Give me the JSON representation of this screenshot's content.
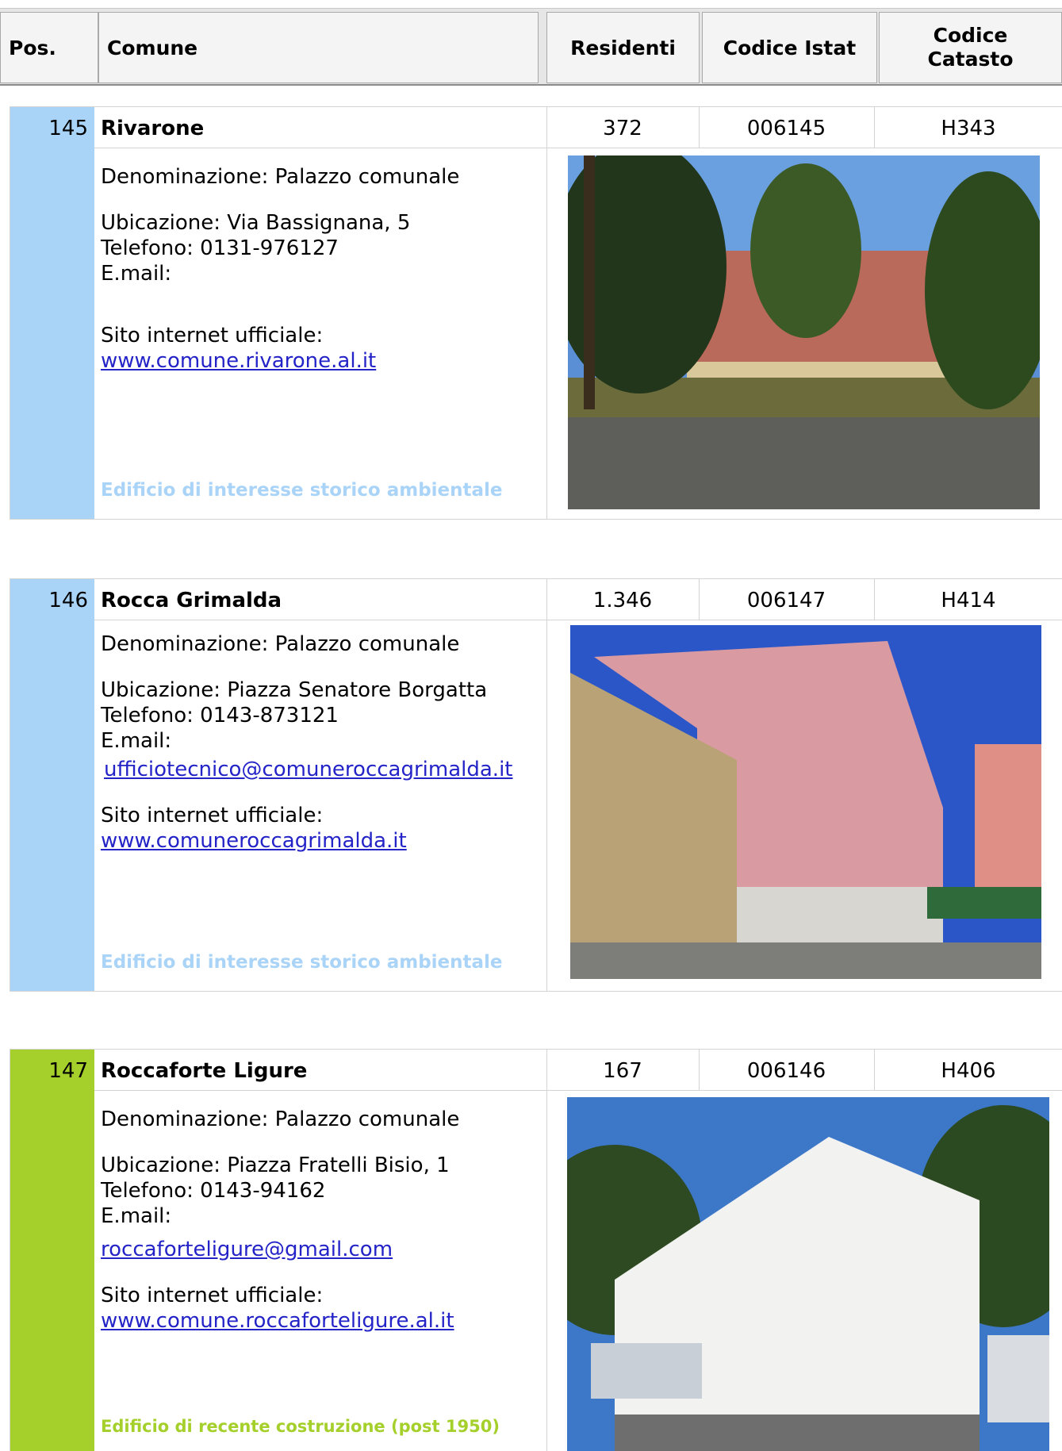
{
  "header": {
    "pos": "Pos.",
    "comune": "Comune",
    "residenti": "Residenti",
    "istat": "Codice Istat",
    "catasto_1": "Codice",
    "catasto_2": "Catasto"
  },
  "records": [
    {
      "pos": "145",
      "name": "Rivarone",
      "residenti": "372",
      "istat": "006145",
      "catasto": "H343",
      "denominazione": "Denominazione: Palazzo comunale",
      "ubicazione": "Ubicazione: Via Bassignana, 5",
      "telefono": "Telefono: 0131-976127",
      "email_label": "E.mail:",
      "email": "",
      "sito_label": "Sito internet ufficiale:",
      "sito": "www.comune.rivarone.al.it",
      "tag": "Edificio di interesse storico ambientale",
      "color": "#a9d3f7",
      "tag_color": "#a9d3f7"
    },
    {
      "pos": "146",
      "name": "Rocca Grimalda",
      "residenti": "1.346",
      "istat": "006147",
      "catasto": "H414",
      "denominazione": "Denominazione: Palazzo comunale",
      "ubicazione": "Ubicazione: Piazza Senatore Borgatta",
      "telefono": "Telefono: 0143-873121",
      "email_label": "E.mail:",
      "email": "ufficiotecnico@comuneroccagrimalda.it",
      "sito_label": "Sito internet ufficiale:",
      "sito": "www.comuneroccagrimalda.it",
      "tag": "Edificio di interesse storico ambientale",
      "color": "#a9d3f7",
      "tag_color": "#a9d3f7"
    },
    {
      "pos": "147",
      "name": "Roccaforte Ligure",
      "residenti": "167",
      "istat": "006146",
      "catasto": "H406",
      "denominazione": "Denominazione: Palazzo comunale",
      "ubicazione": "Ubicazione: Piazza Fratelli Bisio, 1",
      "telefono": "Telefono: 0143-94162",
      "email_label": "E.mail:",
      "email": "roccaforteligure@gmail.com",
      "sito_label": "Sito internet ufficiale:",
      "sito": "www.comune.roccaforteligure.al.it",
      "tag": "Edificio di recente costruzione (post 1950)",
      "color": "#a5cf2a",
      "tag_color": "#a5cf2a"
    }
  ]
}
